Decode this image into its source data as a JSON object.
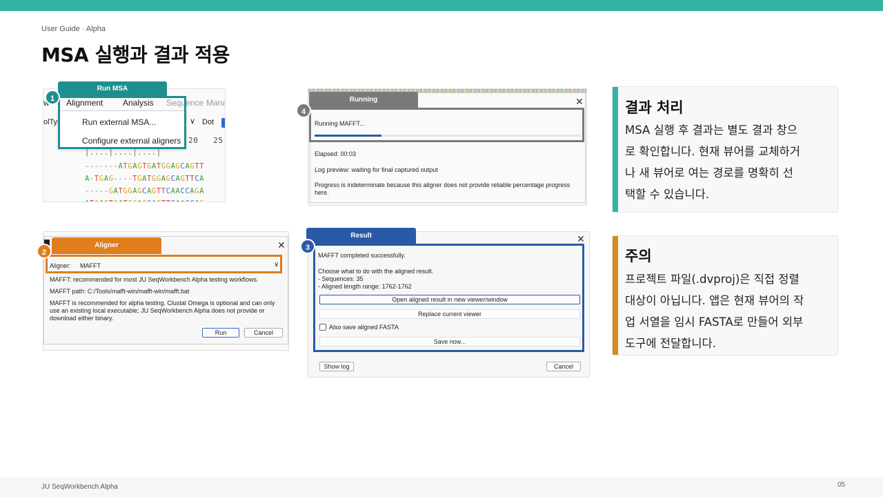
{
  "header": {
    "eyebrow": "User Guide · Alpha",
    "title": "MSA 실행과 결과 적용"
  },
  "footer": {
    "left": "JU SeqWorkbench Alpha",
    "page": "05"
  },
  "step1": {
    "number": "1",
    "tab_label": "Run MSA",
    "menubar": [
      "Alignment",
      "Analysis",
      "Sequence",
      "Mana"
    ],
    "menubar_prefix": "w",
    "toolbar_prefix": "olTyp",
    "toolbar_dot": "Dot",
    "ruler": "20   25",
    "ticks": "|....|....|....|",
    "sequences": [
      "-------ATGAGTGATGGAGCAGTT",
      "A-TGAG----TGATGGAGCAGTTCA",
      "-----GATGGAGCAGTTCAACCAGA",
      "ATGAGTGATGGAGCAGTTCAACCAG"
    ],
    "menu_items": [
      "Run external MSA...",
      "Configure external aligners"
    ]
  },
  "step4": {
    "number": "4",
    "tab_label": "Running",
    "status": "Running MAFFT...",
    "progress": 0.25,
    "elapsed": "Elapsed: 00:03",
    "log_preview": "Log preview: waiting for final captured output",
    "note": "Progress is indeterminate because this aligner does not provide reliable percentage progress here."
  },
  "step2": {
    "number": "2",
    "tab_label": "Aligner",
    "aligner_label": "Aligner:",
    "aligner_value": "MAFFT",
    "desc": "MAFFT: recommended for most JU SeqWorkbench Alpha testing workflows.",
    "path": "MAFFT path: C:/Tools/mafft-win/mafft-win/mafft.bat",
    "note": "MAFFT is recommended for alpha testing. Clustal Omega is optional and can only use an existing local executable; JU SeqWorkbench Alpha does not provide or download either binary.",
    "run_label": "Run",
    "cancel_label": "Cancel"
  },
  "step3": {
    "number": "3",
    "tab_label": "Result",
    "completed": "MAFFT completed successfully.",
    "choose": "Choose what to do with the aligned result.",
    "sequences": "- Sequences: 35",
    "length_range": "- Aligned length range: 1762-1762",
    "open_button": "Open aligned result in new viewer/window",
    "replace_button": "Replace current viewer",
    "save_fasta_label": "Also save aligned FASTA",
    "save_button": "Save now...",
    "show_log": "Show log",
    "cancel_label": "Cancel"
  },
  "cards": [
    {
      "title": "결과 처리",
      "accent": "#35b3a2",
      "lines": [
        "MSA 실행 후 결과는 별도 결과 창으",
        "로 확인합니다. 현재 뷰어를 교체하거",
        "나 새 뷰어로 여는 경로를 명확히 선",
        "택할 수 있습니다."
      ]
    },
    {
      "title": "주의",
      "accent": "#d88a1e",
      "lines": [
        "프로젝트 파일(.dvproj)은 직접 정렬",
        "대상이 아닙니다. 앱은 현재 뷰어의 작",
        "업 서열을 임시 FASTA로 만들어 외부",
        "도구에 전달합니다."
      ]
    }
  ],
  "colors": {
    "teal": "#1e8f8f",
    "gray": "#7a7a7a",
    "orange": "#e07d1d",
    "blue": "#2a5aa6",
    "topbar": "#35b3a2"
  },
  "icons": {
    "close": "close-icon",
    "dropdown": "chevron-down-icon"
  }
}
